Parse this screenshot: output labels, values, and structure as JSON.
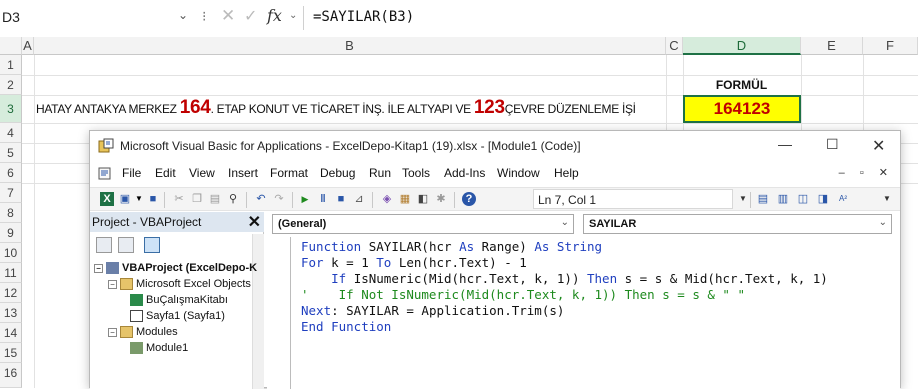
{
  "excel": {
    "name_box": "D3",
    "formula": "=SAYILAR(B3)",
    "columns": [
      "A",
      "B",
      "C",
      "D",
      "E",
      "F"
    ],
    "rows": [
      "1",
      "2",
      "3",
      "4",
      "5",
      "6",
      "7",
      "8",
      "9",
      "10",
      "11",
      "12",
      "13",
      "14",
      "15",
      "16"
    ],
    "d2_label": "FORMÜL",
    "d3_value": "164123",
    "b3": {
      "part1": "HATAY ANTAKYA MERKEZ ",
      "num1": "164",
      "part2": ". ETAP KONUT VE TİCARET İNŞ. İLE ALTYAPI VE ",
      "num2": "123",
      "part3": "ÇEVRE DÜZENLEME İŞİ"
    }
  },
  "vba": {
    "title": "Microsoft Visual Basic for Applications - ExcelDepo-Kitap1 (19).xlsx - [Module1 (Code)]",
    "menu": [
      "File",
      "Edit",
      "View",
      "Insert",
      "Format",
      "Debug",
      "Run",
      "Tools",
      "Add-Ins",
      "Window",
      "Help"
    ],
    "cursor_position": "Ln 7, Col 1",
    "project_title": "Project - VBAProject",
    "tree": {
      "root": "VBAProject (ExcelDepo-K",
      "objects_folder": "Microsoft Excel Objects",
      "workbook": "BuÇalışmaKitabı",
      "sheet": "Sayfa1 (Sayfa1)",
      "modules_folder": "Modules",
      "module": "Module1"
    },
    "combo_general": "(General)",
    "combo_proc": "SAYILAR",
    "code": {
      "l1_kw1": "Function",
      "l1_pl1": " SAYILAR(hcr ",
      "l1_kw2": "As",
      "l1_pl2": " Range) ",
      "l1_kw3": "As String",
      "l2_kw1": "For",
      "l2_pl1": " k = 1 ",
      "l2_kw2": "To",
      "l2_pl2": " Len(hcr.Text) - 1",
      "l3_ind": "    ",
      "l3_kw1": "If",
      "l3_pl1": " IsNumeric(Mid(hcr.Text, k, 1)) ",
      "l3_kw2": "Then",
      "l3_pl2": " s = s & Mid(hcr.Text, k, 1)",
      "l4_comment": "'    If Not IsNumeric(Mid(hcr.Text, k, 1)) Then s = s & \" \"",
      "l5_kw1": "Next",
      "l5_pl1": ": SAYILAR = Application.Trim(s)",
      "l6_kw1": "End Function"
    }
  }
}
